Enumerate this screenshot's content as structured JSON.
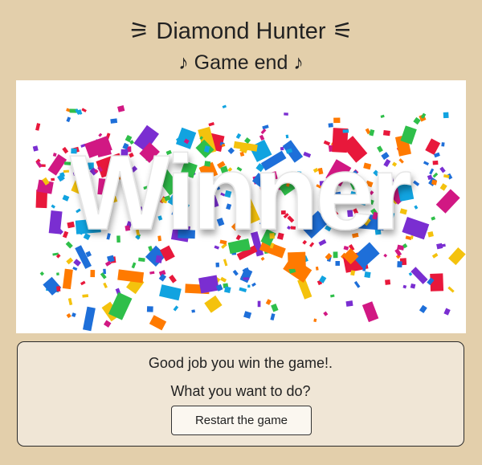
{
  "header": {
    "title": "⚞ Diamond Hunter ⚟",
    "subtitle": "♪ Game end ♪"
  },
  "banner": {
    "word": "Winner",
    "palette": [
      "#e8183b",
      "#1e6fd9",
      "#f4c20d",
      "#ff7a00",
      "#d11883",
      "#7a2ed1",
      "#11a3e0",
      "#2fbf4a"
    ]
  },
  "panel": {
    "message": "Good job you win the game!.",
    "question": "What you want to do?",
    "restart_label": "Restart the game"
  }
}
